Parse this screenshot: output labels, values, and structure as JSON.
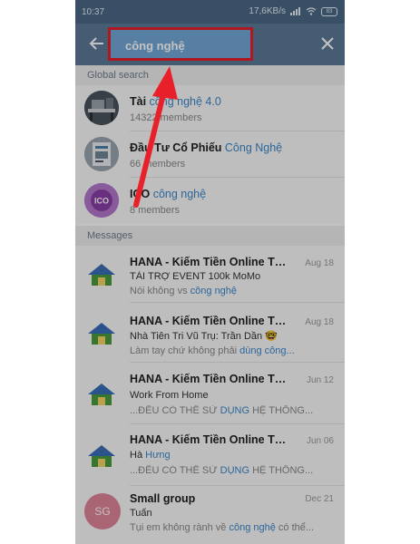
{
  "status_bar": {
    "time": "10:37",
    "network_speed": "17,6KB/s",
    "battery": "83"
  },
  "top_bar": {
    "search_value": "công nghệ"
  },
  "global_search": {
    "header": "Global search",
    "items": [
      {
        "title_pre": "Tài",
        "title_hl": "công nghệ 4.0",
        "subtitle": "14322 members",
        "avatar_icon": "desk-photo-icon"
      },
      {
        "title_pre": "Đầu Tư Cổ Phiếu ",
        "title_hl": "Công Nghệ",
        "subtitle": "66 members",
        "avatar_icon": "book-photo-icon"
      },
      {
        "title_pre": "ICO ",
        "title_hl": "công nghệ",
        "subtitle": "8 members",
        "avatar_icon": "ico-logo",
        "avatar_text": "ICO"
      }
    ]
  },
  "messages": {
    "header": "Messages",
    "items": [
      {
        "title": "HANA - Kiếm Tiền Online Tại...",
        "date": "Aug 18",
        "line2": "TÀI TRỢ EVENT 100k MoMo",
        "line3_pre": "Nói không vs ",
        "line3_hl": "công nghệ",
        "line3_post": ""
      },
      {
        "title": "HANA - Kiếm Tiền Online Tại...",
        "date": "Aug 18",
        "line2": "Nhà Tiên Tri Vũ Trụ: Trần Dần 🤓",
        "line3_pre": "Làm tay chứ không phải ",
        "line3_hl": "dùng công...",
        "line3_post": ""
      },
      {
        "title": "HANA - Kiếm Tiền Online Tại...",
        "date": "Jun 12",
        "line2": "Work From Home",
        "line3_pre": "...ĐỀU CÓ THỂ SỬ ",
        "line3_hl": "DỤNG",
        "line3_post": " HỆ THỐNG..."
      },
      {
        "title": "HANA - Kiếm Tiền Online Tại...",
        "date": "Jun 06",
        "line2_pre": "Hà ",
        "line2_hl": "Hưng",
        "line3_pre": "...ĐỀU CÓ THỂ SỬ ",
        "line3_hl": "DỤNG",
        "line3_post": " HỆ THỐNG..."
      },
      {
        "title": "Small group",
        "date": "Dec 21",
        "line2": "Tuấn",
        "line3_pre": "Tụi em không rành về ",
        "line3_hl": "công nghệ",
        "line3_post": " có thể...",
        "avatar_initials": "SG"
      }
    ]
  },
  "colors": {
    "header": "#5b7a98",
    "status_bar": "#4a6987",
    "highlight": "#3a87c9",
    "annotation": "#e8202a",
    "avatar_sg": "#e0859a"
  }
}
